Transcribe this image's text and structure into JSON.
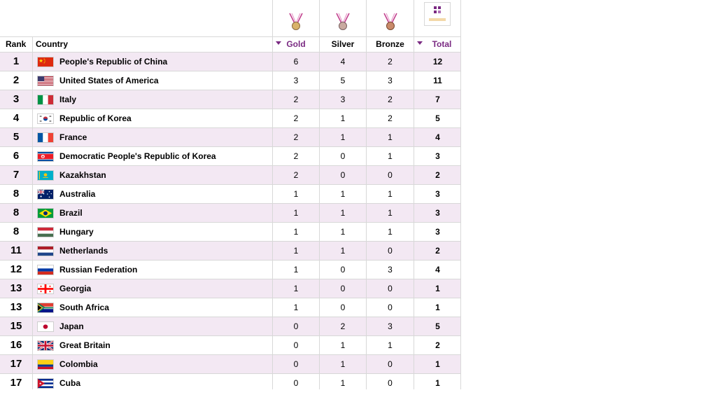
{
  "header": {
    "rank_label": "Rank",
    "country_label": "Country",
    "gold_label": "Gold",
    "silver_label": "Silver",
    "bronze_label": "Bronze",
    "total_label": "Total"
  },
  "colors": {
    "accent": "#7a2a82",
    "row_alt_bg": "#f3e8f3",
    "gold_medal": "#d9b36a",
    "silver_medal": "#c9aaa0",
    "bronze_medal": "#c98a6a"
  },
  "rows": [
    {
      "rank": "1",
      "country": "People's Republic of China",
      "flag": "china-flag",
      "gold": "6",
      "silver": "4",
      "bronze": "2",
      "total": "12"
    },
    {
      "rank": "2",
      "country": "United States of America",
      "flag": "usa-flag",
      "gold": "3",
      "silver": "5",
      "bronze": "3",
      "total": "11"
    },
    {
      "rank": "3",
      "country": "Italy",
      "flag": "italy-flag",
      "gold": "2",
      "silver": "3",
      "bronze": "2",
      "total": "7"
    },
    {
      "rank": "4",
      "country": "Republic of Korea",
      "flag": "south-korea-flag",
      "gold": "2",
      "silver": "1",
      "bronze": "2",
      "total": "5"
    },
    {
      "rank": "5",
      "country": "France",
      "flag": "france-flag",
      "gold": "2",
      "silver": "1",
      "bronze": "1",
      "total": "4"
    },
    {
      "rank": "6",
      "country": "Democratic People's Republic of Korea",
      "flag": "north-korea-flag",
      "gold": "2",
      "silver": "0",
      "bronze": "1",
      "total": "3"
    },
    {
      "rank": "7",
      "country": "Kazakhstan",
      "flag": "kazakhstan-flag",
      "gold": "2",
      "silver": "0",
      "bronze": "0",
      "total": "2"
    },
    {
      "rank": "8",
      "country": "Australia",
      "flag": "australia-flag",
      "gold": "1",
      "silver": "1",
      "bronze": "1",
      "total": "3"
    },
    {
      "rank": "8",
      "country": "Brazil",
      "flag": "brazil-flag",
      "gold": "1",
      "silver": "1",
      "bronze": "1",
      "total": "3"
    },
    {
      "rank": "8",
      "country": "Hungary",
      "flag": "hungary-flag",
      "gold": "1",
      "silver": "1",
      "bronze": "1",
      "total": "3"
    },
    {
      "rank": "11",
      "country": "Netherlands",
      "flag": "netherlands-flag",
      "gold": "1",
      "silver": "1",
      "bronze": "0",
      "total": "2"
    },
    {
      "rank": "12",
      "country": "Russian Federation",
      "flag": "russia-flag",
      "gold": "1",
      "silver": "0",
      "bronze": "3",
      "total": "4"
    },
    {
      "rank": "13",
      "country": "Georgia",
      "flag": "georgia-flag",
      "gold": "1",
      "silver": "0",
      "bronze": "0",
      "total": "1"
    },
    {
      "rank": "13",
      "country": "South Africa",
      "flag": "south-africa-flag",
      "gold": "1",
      "silver": "0",
      "bronze": "0",
      "total": "1"
    },
    {
      "rank": "15",
      "country": "Japan",
      "flag": "japan-flag",
      "gold": "0",
      "silver": "2",
      "bronze": "3",
      "total": "5"
    },
    {
      "rank": "16",
      "country": "Great Britain",
      "flag": "great-britain-flag",
      "gold": "0",
      "silver": "1",
      "bronze": "1",
      "total": "2"
    },
    {
      "rank": "17",
      "country": "Colombia",
      "flag": "colombia-flag",
      "gold": "0",
      "silver": "1",
      "bronze": "0",
      "total": "1"
    },
    {
      "rank": "17",
      "country": "Cuba",
      "flag": "cuba-flag",
      "gold": "0",
      "silver": "1",
      "bronze": "0",
      "total": "1"
    }
  ]
}
